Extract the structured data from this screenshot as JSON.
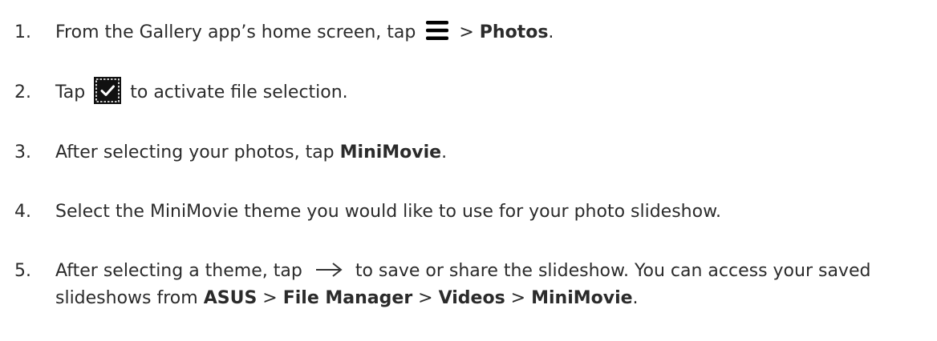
{
  "steps": [
    {
      "number": "1.",
      "t1": "From the Gallery app’s home screen, tap",
      "icon": "menu-icon",
      "t2": " > ",
      "b1": "Photos",
      "t3": "."
    },
    {
      "number": "2.",
      "t1": "Tap",
      "icon": "select-files-icon",
      "t2": "to activate file selection."
    },
    {
      "number": "3.",
      "t1": "After selecting your photos, tap ",
      "b1": "MiniMovie",
      "t2": "."
    },
    {
      "number": "4.",
      "t1": "Select the MiniMovie theme you would like to use for your photo slideshow."
    },
    {
      "number": "5.",
      "t1": "After selecting a theme, tap",
      "icon": "arrow-right-icon",
      "t2": "to save or share the slideshow. You can access your saved slideshows from ",
      "b1": "ASUS",
      "t3": " > ",
      "b2": "File Manager",
      "t4": " > ",
      "b3": "Videos",
      "t5": " > ",
      "b4": "MiniMovie",
      "t6": "."
    }
  ]
}
